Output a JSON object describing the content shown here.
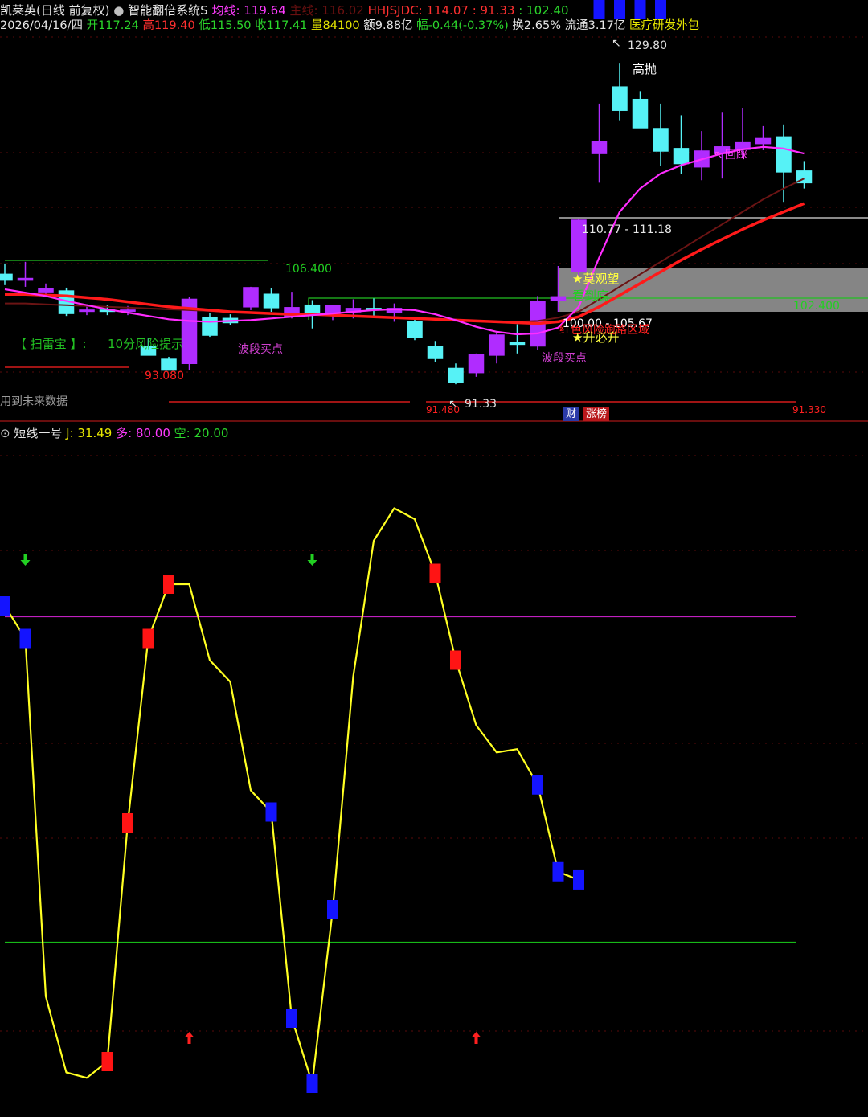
{
  "header1": {
    "stock_name": "凯莱英(日线 前复权)",
    "system_name": "智能翻倍系统S",
    "avg_label": "均线: 119.64",
    "dim_text": "主线: 116.02",
    "hhjsjdc_label": "HHJSJDC: 114.07",
    "hhjsjdc_v2": ": 91.33",
    "hhjsjdc_v3": ": 102.40"
  },
  "header2": {
    "date": "2026/04/16/四",
    "open_label": "开",
    "open": "117.24",
    "high_label": "高",
    "high": "119.40",
    "low_label": "低",
    "low": "115.50",
    "close_label": "收",
    "close": "117.41",
    "vol_label": "量",
    "vol": "84100",
    "amt_label": "额",
    "amt": "9.88亿",
    "chg_label": "幅",
    "chg": "-0.44(-0.37%)",
    "turn_label": "换",
    "turn": "2.65%",
    "float_label": "流通",
    "float": "3.17亿",
    "sector": "医疗研发外包"
  },
  "price_annotations": {
    "high_mark": "129.80",
    "sell_high": "高抛",
    "pullback": "回踩",
    "zone_upper": "110.77 - 111.18",
    "level_106": "106.400",
    "wait": "★莫观望",
    "target_down": "看到底",
    "level_102": "102.400",
    "zone_lower": "100.00 - 105.67",
    "risk_tip": "红色风险跑路区域",
    "must_rise": "★升必升",
    "scan_tag": "【 扫雷宝 】:",
    "scan_tip": "10分风险提示",
    "band_buy1": "波段买点",
    "band_buy2": "波段买点",
    "left_level": "93.080",
    "low_mark": "91.33",
    "bottom_level1": "91.480",
    "bottom_level2": "91.330",
    "future_note": "用到未来数据",
    "badge_cai": "财",
    "badge_zhang": "涨榜"
  },
  "indicator": {
    "name": "短线一号",
    "j_label": "J: 31.49",
    "long_label": "多: 80.00",
    "short_label": "空: 20.00"
  },
  "chart_data": [
    {
      "type": "candlestick",
      "ylim": [
        89,
        133
      ],
      "candles": [
        [
          104.5,
          105.8,
          103.2,
          103.8
        ],
        [
          103.8,
          106.0,
          103.0,
          104.0
        ],
        [
          102.4,
          103.4,
          101.8,
          102.8
        ],
        [
          102.5,
          102.9,
          99.5,
          99.8
        ],
        [
          100.2,
          100.9,
          99.6,
          100.2
        ],
        [
          100.2,
          100.8,
          99.6,
          100.1
        ],
        [
          100.1,
          100.7,
          99.6,
          100.2
        ],
        [
          95.8,
          96.8,
          95.0,
          94.8
        ],
        [
          94.3,
          94.6,
          93.2,
          93.0
        ],
        [
          93.8,
          101.8,
          93.0,
          101.5
        ],
        [
          99.3,
          99.9,
          97.0,
          97.2
        ],
        [
          99.2,
          99.7,
          98.4,
          98.7
        ],
        [
          100.6,
          103.0,
          100.2,
          102.9
        ],
        [
          102.1,
          102.8,
          100.0,
          100.5
        ],
        [
          99.5,
          102.4,
          99.2,
          100.5
        ],
        [
          100.8,
          101.4,
          98.0,
          99.8
        ],
        [
          99.8,
          100.8,
          99.0,
          100.7
        ],
        [
          100.0,
          101.5,
          99.2,
          100.4
        ],
        [
          100.4,
          101.6,
          99.5,
          100.3
        ],
        [
          99.9,
          101.0,
          98.8,
          100.4
        ],
        [
          98.8,
          99.2,
          96.6,
          96.9
        ],
        [
          95.8,
          96.5,
          94.0,
          94.4
        ],
        [
          93.2,
          93.8,
          91.3,
          91.5
        ],
        [
          92.7,
          95.0,
          92.2,
          94.9
        ],
        [
          94.8,
          97.5,
          93.8,
          97.2
        ],
        [
          96.3,
          98.5,
          95.0,
          96.1
        ],
        [
          95.9,
          101.9,
          95.4,
          101.2
        ],
        [
          101.4,
          105.5,
          100.0,
          101.8
        ],
        [
          104.8,
          111.2,
          103.8,
          111.0
        ],
        [
          119.0,
          125.0,
          115.5,
          120.4
        ],
        [
          127.0,
          129.8,
          123.0,
          124.2
        ],
        [
          125.5,
          126.5,
          122.2,
          122.1
        ],
        [
          122.0,
          125.0,
          117.5,
          119.3
        ],
        [
          119.6,
          123.6,
          116.5,
          117.8
        ],
        [
          117.4,
          121.7,
          115.8,
          119.3
        ],
        [
          119.0,
          124.0,
          116.0,
          119.8
        ],
        [
          119.5,
          124.5,
          118.5,
          120.3
        ],
        [
          120.2,
          122.3,
          119.4,
          120.8
        ],
        [
          121.0,
          122.5,
          113.2,
          116.8
        ],
        [
          116.9,
          118.1,
          114.8,
          115.5
        ]
      ],
      "ma_magenta": [
        102.7,
        102.3,
        101.9,
        101.3,
        100.8,
        100.3,
        99.9,
        99.5,
        99.1,
        98.9,
        98.8,
        98.9,
        99.0,
        99.2,
        99.4,
        99.6,
        99.8,
        100.0,
        100.2,
        100.3,
        100.2,
        99.7,
        99.0,
        98.2,
        97.6,
        97.3,
        97.4,
        98.1,
        100.6,
        106.5,
        112.0,
        114.8,
        116.6,
        117.6,
        118.3,
        119.0,
        119.5,
        119.8,
        119.6,
        119.0
      ],
      "ma_red": [
        102.1,
        102.1,
        102.0,
        101.9,
        101.7,
        101.5,
        101.2,
        100.9,
        100.6,
        100.4,
        100.2,
        100.0,
        99.9,
        99.8,
        99.7,
        99.7,
        99.6,
        99.5,
        99.4,
        99.3,
        99.2,
        99.1,
        99.0,
        98.9,
        98.8,
        98.7,
        98.6,
        98.8,
        99.4,
        100.6,
        102.0,
        103.4,
        104.8,
        106.2,
        107.5,
        108.7,
        109.9,
        111.0,
        112.0,
        113.0
      ],
      "ma_darkred": [
        101.0,
        101.0,
        100.9,
        100.8,
        100.7,
        100.6,
        100.5,
        100.4,
        100.3,
        100.2,
        100.1,
        100.0,
        99.9,
        99.8,
        99.8,
        99.7,
        99.6,
        99.5,
        99.4,
        99.3,
        99.2,
        99.1,
        99.0,
        98.9,
        98.8,
        98.8,
        98.9,
        99.3,
        100.0,
        101.5,
        103.0,
        104.5,
        106.0,
        107.5,
        109.0,
        110.5,
        112.0,
        113.5,
        114.8,
        116.0
      ]
    },
    {
      "type": "line",
      "title": "短线一号",
      "ylim": [
        -10,
        110
      ],
      "series": [
        {
          "name": "J",
          "values": [
            82.0,
            76.0,
            10.0,
            -4.0,
            -5.0,
            -2.0,
            42.0,
            76.0,
            86.0,
            86.0,
            72.0,
            68.0,
            48.0,
            44.0,
            6.0,
            -6.0,
            26.0,
            69.0,
            94.0,
            100.0,
            98.0,
            88.0,
            72.0,
            60.0,
            55.0,
            55.6,
            49.0,
            33.0,
            31.49
          ]
        }
      ],
      "hlines": [
        80,
        50,
        20
      ],
      "blue_points": [
        0,
        1,
        13,
        14,
        15,
        16,
        26,
        27,
        28,
        29,
        30,
        31,
        32
      ],
      "red_points": [
        5,
        6,
        7,
        8,
        21,
        22
      ],
      "down_arrows": [
        1,
        15
      ],
      "up_arrows": [
        9,
        23
      ]
    }
  ],
  "colors": {
    "up_candle": "#b02cff",
    "down_candle": "#56f2f6",
    "ma_magenta": "#ff2cff",
    "ma_red": "#ff1a1a",
    "ma_darkred": "#6b1414",
    "j_line": "#ffff22",
    "blue_box": "#1414ff",
    "red_box": "#ff1414",
    "hline_top": "#c020c0",
    "hline_bottom": "#18b818"
  }
}
